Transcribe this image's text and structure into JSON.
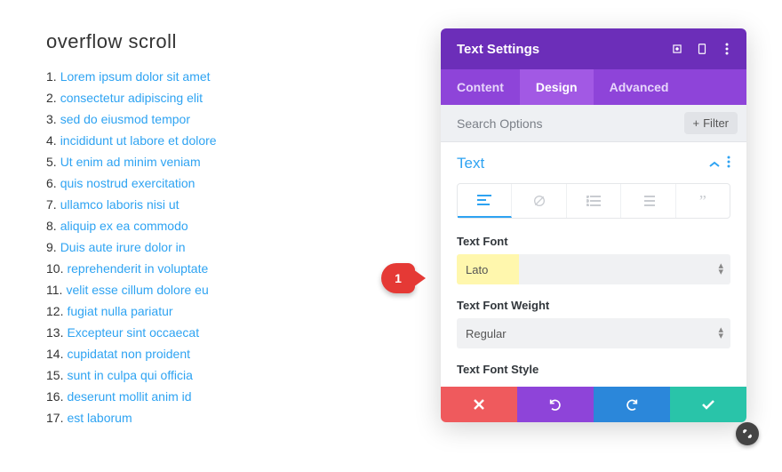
{
  "left": {
    "title": "overflow scroll",
    "items": [
      "Lorem ipsum dolor sit amet",
      "consectetur adipiscing elit",
      "sed do eiusmod tempor",
      "incididunt ut labore et dolore",
      "Ut enim ad minim veniam",
      "quis nostrud exercitation",
      "ullamco laboris nisi ut",
      "aliquip ex ea commodo",
      "Duis aute irure dolor in",
      "reprehenderit in voluptate",
      "velit esse cillum dolore eu",
      "fugiat nulla pariatur",
      "Excepteur sint occaecat",
      "cupidatat non proident",
      "sunt in culpa qui officia",
      "deserunt mollit anim id",
      "est laborum"
    ]
  },
  "panel": {
    "title": "Text Settings",
    "tabs": {
      "content": "Content",
      "design": "Design",
      "advanced": "Advanced"
    },
    "search_placeholder": "Search Options",
    "filter_label": "Filter",
    "section": "Text",
    "font_label": "Text Font",
    "font_value": "Lato",
    "weight_label": "Text Font Weight",
    "weight_value": "Regular",
    "style_label": "Text Font Style"
  },
  "marker": "1"
}
